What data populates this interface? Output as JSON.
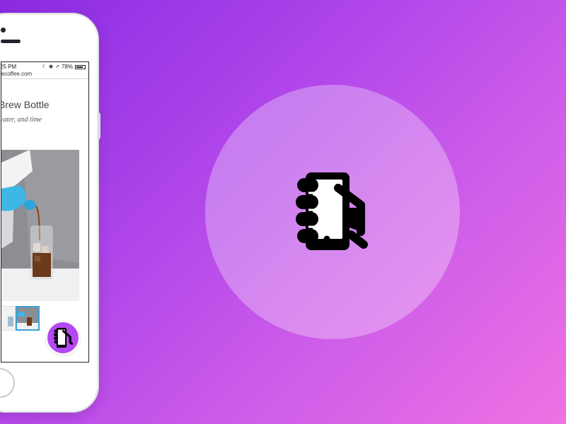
{
  "status_bar": {
    "time": "25 PM",
    "battery_percent": "78%",
    "battery_level": 0.78
  },
  "browser": {
    "url": "lecoffee.com"
  },
  "product": {
    "title": "Brew Bottle",
    "subtitle": "vater, and time"
  },
  "thumbnails": {
    "selected_index": 1,
    "count": 2
  },
  "colors": {
    "background_start": "#8a2be2",
    "background_end": "#ee72e3",
    "badge": "#b349f0",
    "thumb_selected_border": "#3aa0d8"
  },
  "icons": {
    "hero": "hand-holding-phone-icon",
    "badge": "hand-holding-phone-icon"
  }
}
